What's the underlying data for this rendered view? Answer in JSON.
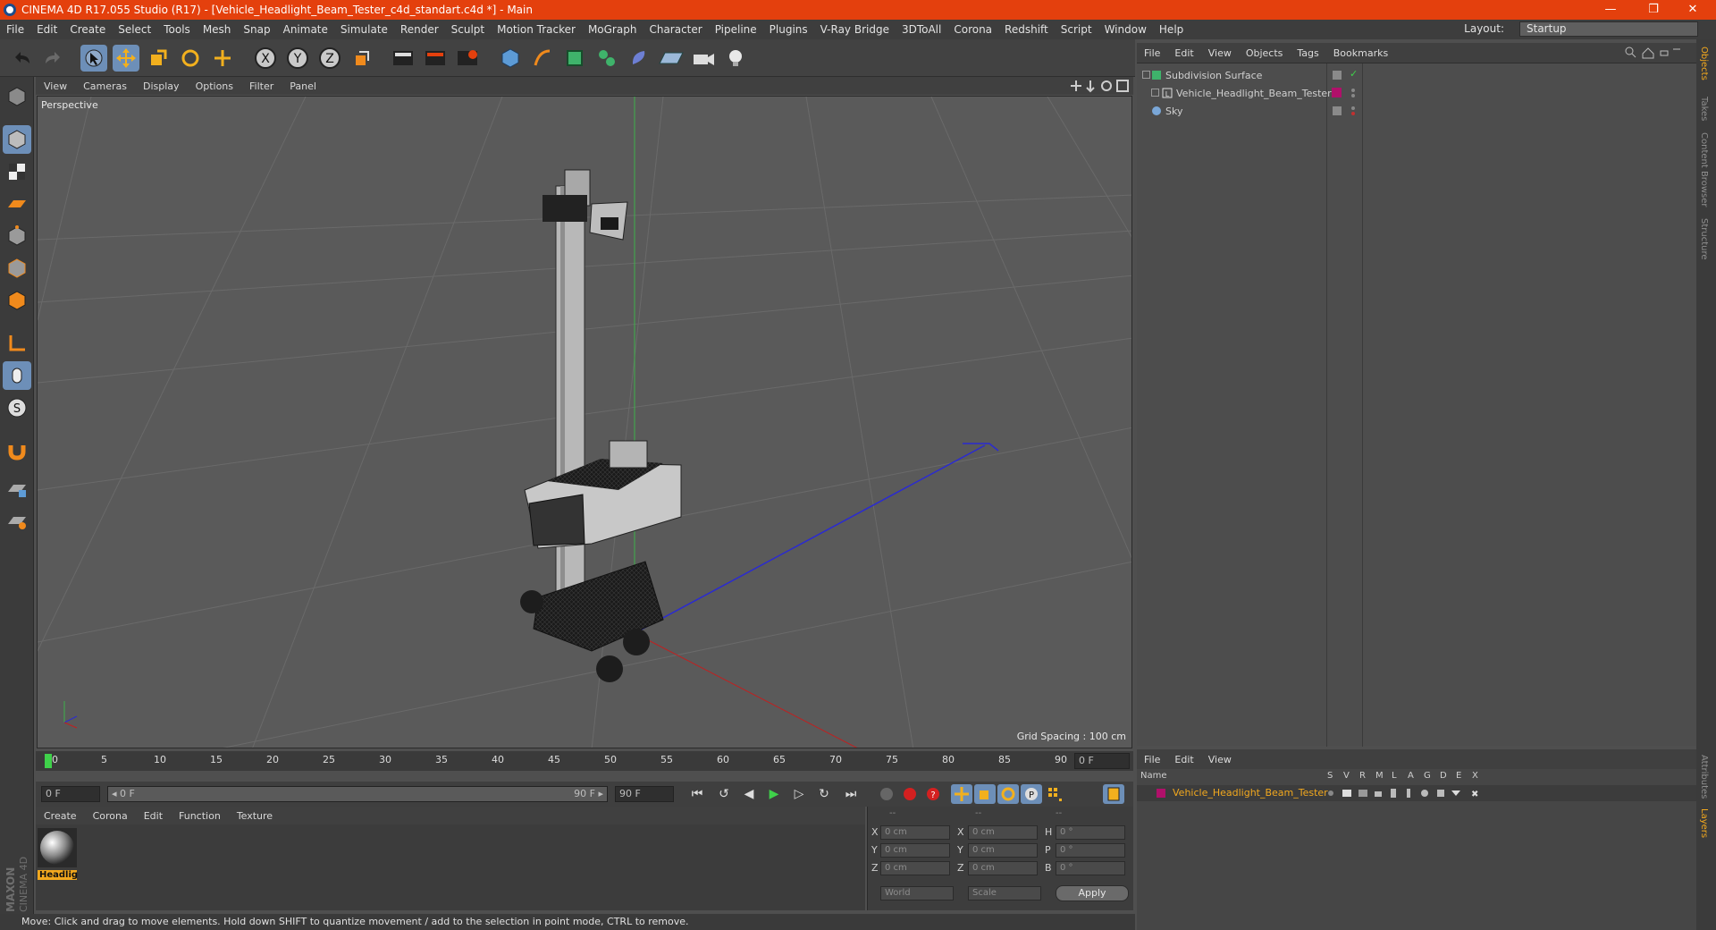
{
  "window": {
    "title": "CINEMA 4D R17.055 Studio (R17) - [Vehicle_Headlight_Beam_Tester_c4d_standart.c4d *] - Main",
    "minimize": "—",
    "maximize": "❐",
    "close": "✕"
  },
  "menubar": {
    "items": [
      "File",
      "Edit",
      "Create",
      "Select",
      "Tools",
      "Mesh",
      "Snap",
      "Animate",
      "Simulate",
      "Render",
      "Sculpt",
      "Motion Tracker",
      "MoGraph",
      "Character",
      "Pipeline",
      "Plugins",
      "V-Ray Bridge",
      "3DToAll",
      "Corona",
      "Redshift",
      "Script",
      "Window",
      "Help"
    ],
    "layout_label": "Layout:",
    "layout_value": "Startup"
  },
  "viewport": {
    "menu": [
      "View",
      "Cameras",
      "Display",
      "Options",
      "Filter",
      "Panel"
    ],
    "label": "Perspective",
    "grid_spacing": "Grid Spacing : 100 cm"
  },
  "timeline": {
    "ticks": [
      "0",
      "5",
      "10",
      "15",
      "20",
      "25",
      "30",
      "35",
      "40",
      "45",
      "50",
      "55",
      "60",
      "65",
      "70",
      "75",
      "80",
      "85",
      "90"
    ],
    "current_frame": "0 F"
  },
  "playback": {
    "start_field": "0 F",
    "range_start": "◂ 0 F",
    "range_end": "90 F ▸",
    "end_field": "90 F"
  },
  "material": {
    "menu": [
      "Create",
      "Corona",
      "Edit",
      "Function",
      "Texture"
    ],
    "item_label": "Headlig"
  },
  "coordinates": {
    "headers": [
      "--",
      "--",
      "--"
    ],
    "rows": [
      {
        "a": "X",
        "av": "0 cm",
        "b": "X",
        "bv": "0 cm",
        "c": "H",
        "cv": "0 °"
      },
      {
        "a": "Y",
        "av": "0 cm",
        "b": "Y",
        "bv": "0 cm",
        "c": "P",
        "cv": "0 °"
      },
      {
        "a": "Z",
        "av": "0 cm",
        "b": "Z",
        "bv": "0 cm",
        "c": "B",
        "cv": "0 °"
      }
    ],
    "mode": "World",
    "type": "Scale",
    "apply": "Apply"
  },
  "objects_panel": {
    "menu": [
      "File",
      "Edit",
      "View",
      "Objects",
      "Tags",
      "Bookmarks"
    ],
    "items": [
      "Subdivision Surface",
      "Vehicle_Headlight_Beam_Tester",
      "Sky"
    ]
  },
  "right_tabs": [
    "Objects",
    "Takes",
    "Content Browser",
    "Structure",
    "Attributes",
    "Layers"
  ],
  "layers_panel": {
    "menu": [
      "File",
      "Edit",
      "View"
    ],
    "columns": [
      "Name",
      "S",
      "V",
      "R",
      "M",
      "L",
      "A",
      "G",
      "D",
      "E",
      "X"
    ],
    "layer_name": "Vehicle_Headlight_Beam_Tester",
    "layer_color": "#b0106a"
  },
  "status": "Move: Click and drag to move elements. Hold down SHIFT to quantize movement / add to the selection in point mode, CTRL to remove.",
  "brand": {
    "line1": "MAXON",
    "line2": "CINEMA 4D"
  }
}
